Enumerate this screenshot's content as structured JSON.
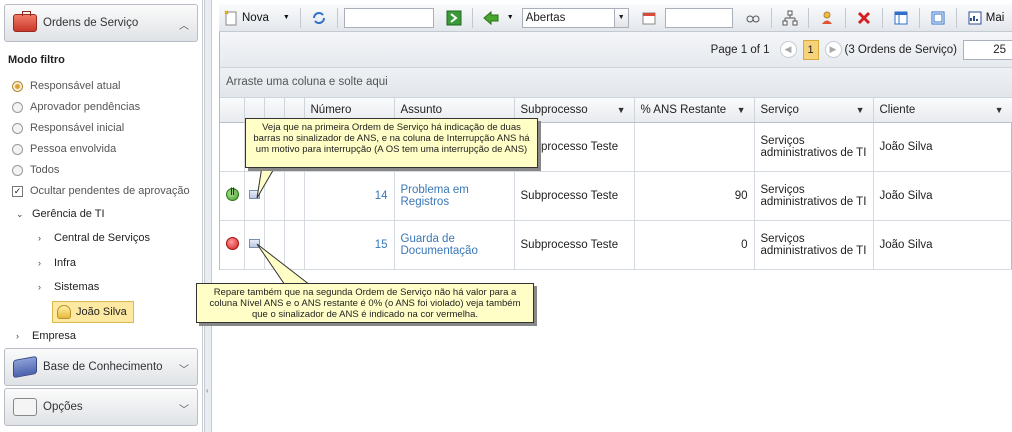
{
  "left_panel": {
    "sections": {
      "orders": "Ordens de Serviço",
      "knowledge": "Base de Conhecimento",
      "options": "Opções"
    },
    "filter_title": "Modo filtro",
    "filters": [
      {
        "label": "Responsável atual",
        "checked": true
      },
      {
        "label": "Aprovador pendências",
        "checked": false
      },
      {
        "label": "Responsável inicial",
        "checked": false
      },
      {
        "label": "Pessoa envolvida",
        "checked": false
      },
      {
        "label": "Todos",
        "checked": false
      }
    ],
    "hide_pending": {
      "label": "Ocultar pendentes de aprovação",
      "checked": true
    },
    "tree": {
      "root": "Gerência de TI",
      "children": [
        "Central de Serviços",
        "Infra",
        "Sistemas"
      ],
      "selected": "João Silva",
      "other": "Empresa"
    }
  },
  "toolbar": {
    "new_label": "Nova",
    "status_value": "Abertas",
    "more_label": "Mai"
  },
  "pager": {
    "page_text": "Page 1 of 1",
    "current": "1",
    "count_text": "(3 Ordens de Serviço)",
    "page_size": "25"
  },
  "group_zone": "Arraste uma coluna e solte aqui",
  "columns": {
    "numero": "Número",
    "assunto": "Assunto",
    "subprocesso": "Subprocesso",
    "ans": "% ANS Restante",
    "servico": "Serviço",
    "cliente": "Cliente"
  },
  "rows": [
    {
      "sla": "",
      "numero": "",
      "assunto": "",
      "subprocesso": "Subprocesso Teste",
      "ans": "",
      "servico": "Serviços administrativos de TI",
      "cliente": "João Silva"
    },
    {
      "sla": "green",
      "numero": "14",
      "assunto": "Problema em Registros",
      "subprocesso": "Subprocesso Teste",
      "ans": "90",
      "servico": "Serviços administrativos de TI",
      "cliente": "João Silva"
    },
    {
      "sla": "red",
      "numero": "15",
      "assunto": "Guarda de Documentação",
      "subprocesso": "Subprocesso Teste",
      "ans": "0",
      "servico": "Serviços administrativos de TI",
      "cliente": "João Silva"
    }
  ],
  "callouts": {
    "first": "Veja que na primeira Ordem de Serviço há indicação de duas barras no sinalizador de ANS, e na coluna de Interrupção ANS há um motivo para interrupção (A OS tem uma interrupção de ANS)",
    "second": "Repare também que na segunda Ordem de Serviço não há valor para a coluna Nível ANS e o ANS restante é 0% (o ANS foi violado) veja também que o sinalizador de ANS é indicado na cor vermelha."
  }
}
